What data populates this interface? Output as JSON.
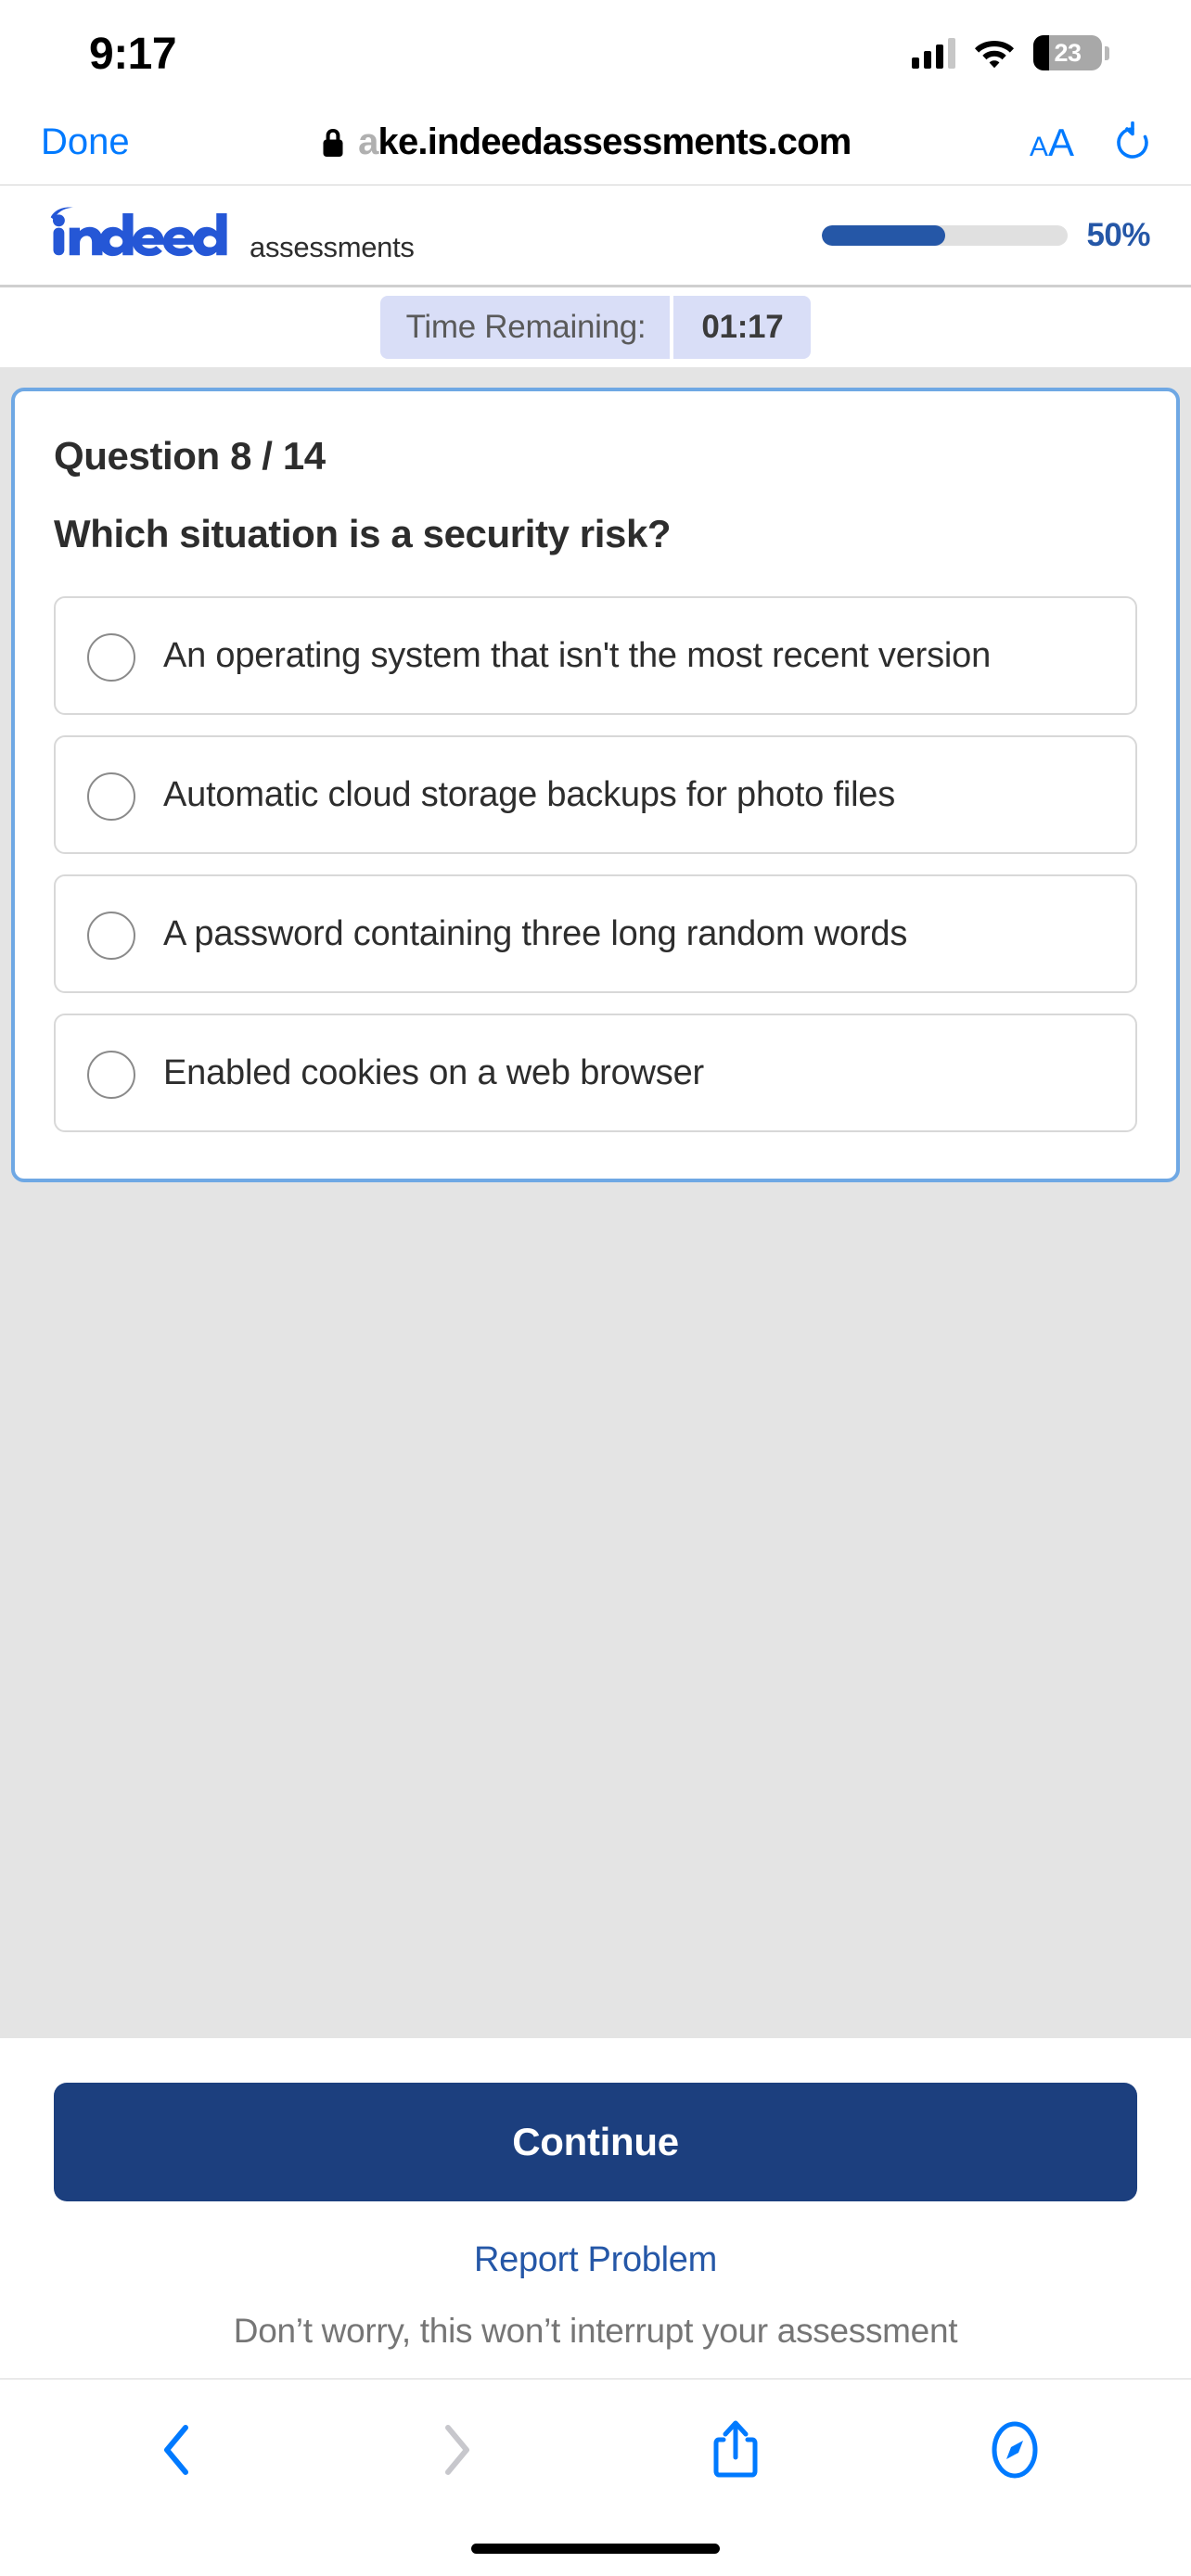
{
  "status_bar": {
    "time": "9:17",
    "battery_level": "23",
    "signal_icon": "cellular-signal-icon",
    "wifi_icon": "wifi-icon",
    "battery_icon": "battery-icon"
  },
  "browser": {
    "done_label": "Done",
    "url_prefix_faded": "a",
    "url_text": "ke.indeedassessments.com",
    "lock_icon": "lock-icon",
    "text_size_small": "A",
    "text_size_large": "A",
    "reload_icon": "reload-icon",
    "toolbar": {
      "back_icon": "back-chevron-icon",
      "forward_icon": "forward-chevron-icon",
      "share_icon": "share-icon",
      "tabs_icon": "safari-compass-icon"
    }
  },
  "site_header": {
    "brand_name": "indeed",
    "brand_sub": "assessments",
    "progress_percent_label": "50%",
    "progress_percent_value": 50
  },
  "timer": {
    "label": "Time Remaining:",
    "value": "01:17"
  },
  "question": {
    "number_label": "Question 8 / 14",
    "current": 8,
    "total": 14,
    "prompt": "Which situation is a security risk?",
    "options": [
      {
        "text": "An operating system that isn't the most recent version",
        "selected": false
      },
      {
        "text": "Automatic cloud storage backups for photo files",
        "selected": false
      },
      {
        "text": "A password containing three long random words",
        "selected": false
      },
      {
        "text": "Enabled cookies on a web browser",
        "selected": false
      }
    ]
  },
  "footer": {
    "continue_label": "Continue",
    "report_label": "Report Problem",
    "disclaimer": "Don’t worry, this won’t interrupt your assessment"
  },
  "colors": {
    "indeed_blue": "#2557a7",
    "continue_navy": "#1c3f7e",
    "ios_blue": "#007aff",
    "focus_border": "#6fa8e4",
    "page_gray": "#e4e4e4",
    "timer_lavender": "#d9def7"
  }
}
